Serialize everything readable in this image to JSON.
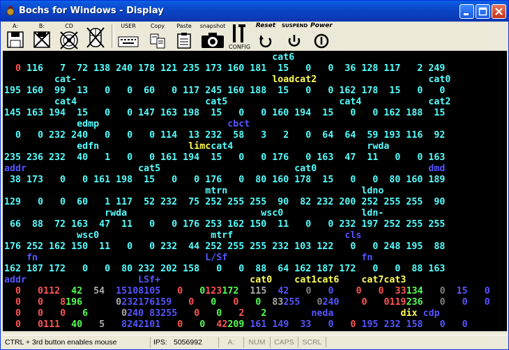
{
  "window": {
    "title": "Bochs for Windows - Display"
  },
  "toolbar": {
    "items": [
      {
        "label": "A:",
        "icon": "floppy-a-icon"
      },
      {
        "label": "B:",
        "icon": "floppy-b-icon"
      },
      {
        "label": "CD",
        "icon": "cdrom-icon"
      },
      {
        "label": "",
        "icon": "mouse-icon"
      },
      {
        "label": "USER",
        "icon": "keyboard-icon"
      },
      {
        "label": "Copy",
        "icon": "copy-icon"
      },
      {
        "label": "Paste",
        "icon": "paste-icon"
      },
      {
        "label": "snapshot",
        "icon": "camera-icon"
      },
      {
        "label": "CONFIG",
        "icon": "config-icon"
      },
      {
        "label": "Reset",
        "icon": "reset-icon"
      },
      {
        "label": "SUSPEND",
        "icon": "suspend-icon"
      },
      {
        "label": "Power",
        "icon": "power-icon"
      }
    ]
  },
  "colors": {
    "cyan": "#55ffff",
    "red": "#ff5555",
    "yellow": "#ffff55",
    "blue": "#5555ff",
    "green": "#55ff55",
    "grey": "#aaaaaa",
    "white": "#ffffff",
    "darkgrey": "#808080"
  },
  "screen_rows": [
    [
      {
        "t": "                                                cat6",
        "c": "cyan"
      }
    ],
    [
      {
        "t": "  0",
        "c": "red"
      },
      {
        "t": " 116   7  72 138 240 178 121 235 173 160 181  15   0   0  36 128 117   2 249",
        "c": "cyan"
      }
    ],
    [
      {
        "t": "         cat-                                   ",
        "c": "cyan"
      },
      {
        "t": "loadcat2",
        "c": "yellow"
      },
      {
        "t": "                    cat0",
        "c": "cyan"
      }
    ],
    [
      {
        "t": "195 160  99  13   0   0  60   0 117 245 160 188  15   0   0 162 178  15   0   0",
        "c": "cyan"
      }
    ],
    [
      {
        "t": "         cat4                       cat5                    cat4            cat2",
        "c": "cyan"
      }
    ],
    [
      {
        "t": "145 163 194  15   0   0 147 163 198  15   0   0 160 194  15   0   0 162 188  15",
        "c": "cyan"
      }
    ],
    [
      {
        "t": "             edmp                       ",
        "c": "cyan"
      },
      {
        "t": "cbct",
        "c": "blue"
      }
    ],
    [
      {
        "t": "  0   0 232 240   0   0   0 114  13 232  58   3   2   0  64  64  59 193 116  92",
        "c": "cyan"
      }
    ],
    [
      {
        "t": "             edfn                ",
        "c": "cyan"
      },
      {
        "t": "limc",
        "c": "yellow"
      },
      {
        "t": "cat4                        rwda",
        "c": "cyan"
      }
    ],
    [
      {
        "t": "235 236 232  40   1   0   0 161 194  15   0   0 176   0 163  47  11   0   0 163",
        "c": "cyan"
      }
    ],
    [
      {
        "t": "addr",
        "c": "blue"
      },
      {
        "t": "                    cat5                        cat0                    ",
        "c": "cyan"
      },
      {
        "t": "dmd",
        "c": "blue"
      }
    ],
    [
      {
        "t": " 38 173   0   0 161 198  15   0   0 176   0  80 160 178  15   0   0  80 160 189",
        "c": "cyan"
      }
    ],
    [
      {
        "t": "                                    mtrn                        ldno",
        "c": "cyan"
      }
    ],
    [
      {
        "t": "129   0   0  60   1 117  52 232  75 252 255 255  90  82 232 200 252 255 255  90",
        "c": "cyan"
      }
    ],
    [
      {
        "t": "                  rwda                        wsc0              ldn-",
        "c": "cyan"
      }
    ],
    [
      {
        "t": " 66  88  72 163  47  11   0   0 176 253 162 150  11   0   0 232 197 252 255 255",
        "c": "cyan"
      }
    ],
    [
      {
        "t": "             wsc0                    mtrf                    ",
        "c": "cyan"
      },
      {
        "t": "cls",
        "c": "blue"
      }
    ],
    [
      {
        "t": "176 252 162 150  11   0   0 232  44 252 255 255 232 103 122   0   0 248 195  88",
        "c": "cyan"
      }
    ],
    [
      {
        "t": "    ",
        "c": "cyan"
      },
      {
        "t": "fn",
        "c": "blue"
      },
      {
        "t": "                              ",
        "c": "cyan"
      },
      {
        "t": "L/Sf",
        "c": "blue"
      },
      {
        "t": "                        ",
        "c": "cyan"
      },
      {
        "t": "fn",
        "c": "blue"
      }
    ],
    [
      {
        "t": "162 187 172   0   0  80 232 202 158   0   0  88  64 162 187 172   0   0  88 163",
        "c": "cyan"
      }
    ],
    [
      {
        "t": "addr",
        "c": "blue"
      },
      {
        "t": "                    ",
        "c": "cyan"
      },
      {
        "t": "LSf+",
        "c": "blue"
      },
      {
        "t": "                ",
        "c": "cyan"
      },
      {
        "t": "cat0    cat1cat6    cat7cat3",
        "c": "yellow"
      }
    ],
    [
      {
        "t": "  0",
        "c": "red"
      },
      {
        "t": "   0",
        "c": "red"
      },
      {
        "t": "112",
        "c": "red"
      },
      {
        "t": "  42",
        "c": "green"
      },
      {
        "t": "  54",
        "c": "grey"
      },
      {
        "t": "  15",
        "c": "blue"
      },
      {
        "t": "108105",
        "c": "blue"
      },
      {
        "t": "   0",
        "c": "red"
      },
      {
        "t": "   0",
        "c": "green"
      },
      {
        "t": "123",
        "c": "red"
      },
      {
        "t": "172",
        "c": "green"
      },
      {
        "t": "  115",
        "c": "grey"
      },
      {
        "t": "  42",
        "c": "blue"
      },
      {
        "t": "   0",
        "c": "darkgrey"
      },
      {
        "t": "   0",
        "c": "blue"
      },
      {
        "t": "    0",
        "c": "red"
      },
      {
        "t": "   0",
        "c": "red"
      },
      {
        "t": "  33",
        "c": "red"
      },
      {
        "t": "134",
        "c": "green"
      },
      {
        "t": "   0",
        "c": "darkgrey"
      },
      {
        "t": "  15",
        "c": "blue"
      },
      {
        "t": "   0",
        "c": "blue"
      },
      {
        "t": "   0",
        "c": "blue"
      }
    ],
    [
      {
        "t": "  0",
        "c": "red"
      },
      {
        "t": "   0",
        "c": "red"
      },
      {
        "t": "   8",
        "c": "red"
      },
      {
        "t": "196",
        "c": "green"
      },
      {
        "t": "      0",
        "c": "grey"
      },
      {
        "t": "232176159",
        "c": "blue"
      },
      {
        "t": "   0",
        "c": "red"
      },
      {
        "t": "   0",
        "c": "green"
      },
      {
        "t": "   0",
        "c": "red"
      },
      {
        "t": "   0",
        "c": "green"
      },
      {
        "t": "  83",
        "c": "grey"
      },
      {
        "t": "255",
        "c": "blue"
      },
      {
        "t": "   0",
        "c": "darkgrey"
      },
      {
        "t": "240",
        "c": "blue"
      },
      {
        "t": "    0",
        "c": "red"
      },
      {
        "t": "   0",
        "c": "red"
      },
      {
        "t": "119",
        "c": "red"
      },
      {
        "t": "236",
        "c": "green"
      },
      {
        "t": "   0",
        "c": "darkgrey"
      },
      {
        "t": "   0",
        "c": "blue"
      },
      {
        "t": "   0",
        "c": "blue"
      },
      {
        "t": "   0",
        "c": "blue"
      }
    ],
    [
      {
        "t": "  0",
        "c": "red"
      },
      {
        "t": "   0",
        "c": "red"
      },
      {
        "t": "   0",
        "c": "red"
      },
      {
        "t": "   6",
        "c": "green"
      },
      {
        "t": "      0",
        "c": "grey"
      },
      {
        "t": "240",
        "c": "blue"
      },
      {
        "t": " 83255",
        "c": "blue"
      },
      {
        "t": "   0",
        "c": "red"
      },
      {
        "t": "   0",
        "c": "green"
      },
      {
        "t": "   2",
        "c": "red"
      },
      {
        "t": "   2",
        "c": "green"
      },
      {
        "t": "        ",
        "c": "grey"
      },
      {
        "t": "neda",
        "c": "blue"
      },
      {
        "t": "            ",
        "c": "grey"
      },
      {
        "t": "dix",
        "c": "yellow"
      },
      {
        "t": " cdp",
        "c": "blue"
      }
    ],
    [
      {
        "t": "  0",
        "c": "red"
      },
      {
        "t": "   0",
        "c": "red"
      },
      {
        "t": "111",
        "c": "red"
      },
      {
        "t": "  40",
        "c": "green"
      },
      {
        "t": "   5",
        "c": "grey"
      },
      {
        "t": "   8",
        "c": "blue"
      },
      {
        "t": "242101",
        "c": "blue"
      },
      {
        "t": "   0",
        "c": "red"
      },
      {
        "t": "   0",
        "c": "green"
      },
      {
        "t": "  42",
        "c": "red"
      },
      {
        "t": "209",
        "c": "green"
      },
      {
        "t": " 161 149  33",
        "c": "blue"
      },
      {
        "t": "   0",
        "c": "blue"
      },
      {
        "t": "   0",
        "c": "red"
      },
      {
        "t": " 195 232 158",
        "c": "blue"
      },
      {
        "t": "   0",
        "c": "blue"
      },
      {
        "t": "   0",
        "c": "blue"
      }
    ]
  ],
  "statusbar": {
    "hint": "CTRL + 3rd button enables mouse",
    "ips_label": "IPS:",
    "ips_value": "5056992",
    "drive": "A:",
    "num": "NUM",
    "caps": "CAPS",
    "scrl": "SCRL"
  }
}
